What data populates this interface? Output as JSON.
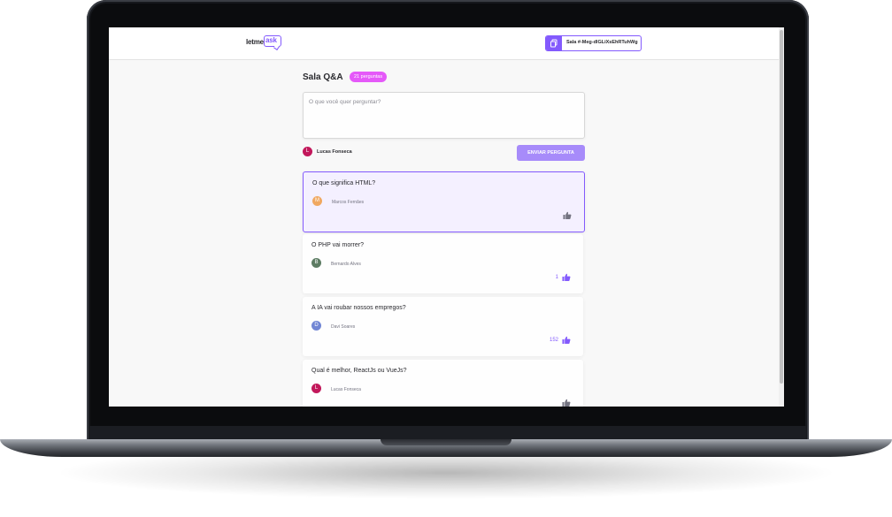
{
  "header": {
    "logo_text_1": "letme",
    "logo_text_2": "ask",
    "room_code": "Sala #-Meg-dlGLiXsEhRTuhWg"
  },
  "room": {
    "title": "Sala Q&A",
    "question_count": "21 perguntas"
  },
  "form": {
    "placeholder": "O que você quer perguntar?",
    "user_name": "Lucas Fonseca",
    "user_initial": "L",
    "submit_label": "ENVIAR PERGUNTA"
  },
  "questions": [
    {
      "text": "O que significa HTML?",
      "author": "Marcos Fernães",
      "initial": "M",
      "avatar_color": "#f0a861",
      "likes": "",
      "like_icon_color": "#737380",
      "highlighted": true
    },
    {
      "text": "O PHP vai morrer?",
      "author": "Bernardo Alves",
      "initial": "B",
      "avatar_color": "#5d7c63",
      "likes": "1",
      "like_icon_color": "#835afd",
      "highlighted": false
    },
    {
      "text": "A IA vai roubar nossos empregos?",
      "author": "Davi Soares",
      "initial": "D",
      "avatar_color": "#7186d4",
      "likes": "152",
      "like_icon_color": "#835afd",
      "highlighted": false
    },
    {
      "text": "Qual é melhor, ReactJs ou VueJs?",
      "author": "Lucas Fonseca",
      "initial": "L",
      "avatar_color": "#c2185b",
      "likes": "",
      "like_icon_color": "#737380",
      "highlighted": false
    }
  ],
  "colors": {
    "accent": "#835afd",
    "badge": "#e559f9",
    "user_avatar": "#c2185b"
  }
}
